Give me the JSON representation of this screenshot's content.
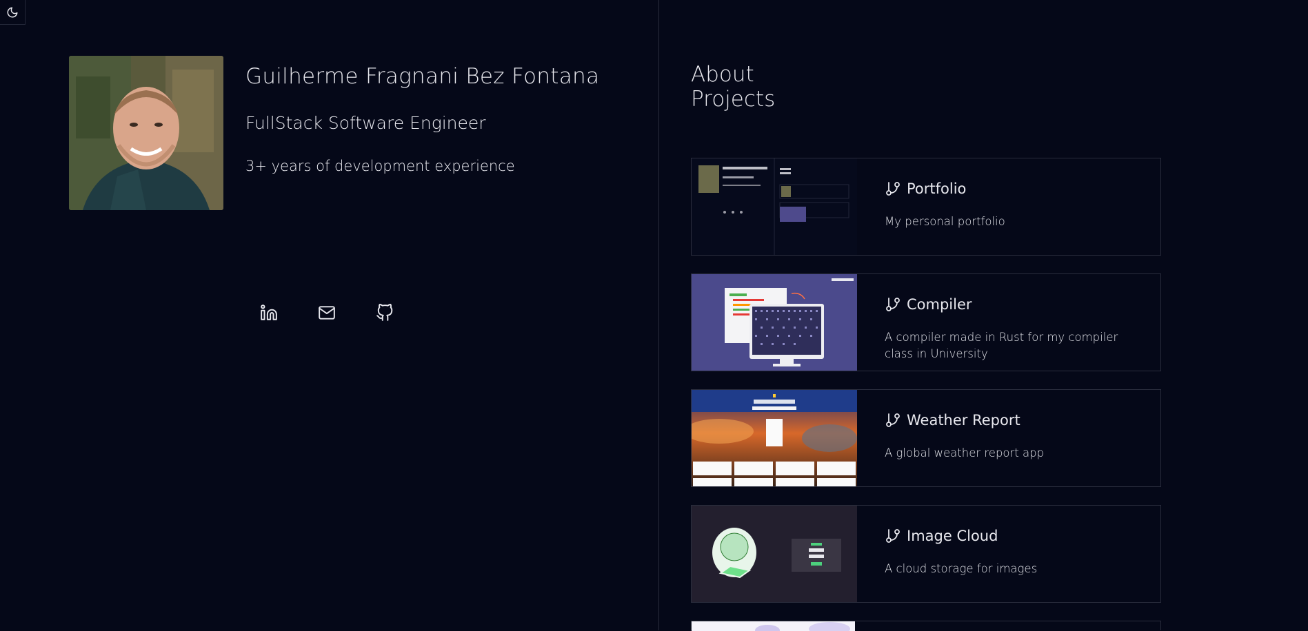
{
  "theme_toggle": {
    "icon": "moon-icon"
  },
  "profile": {
    "name": "Guilherme Fragnani Bez Fontana",
    "role": "FullStack Software Engineer",
    "experience": "3+ years of development experience",
    "photo_alt": "Profile photo"
  },
  "socials": [
    {
      "icon": "linkedin-icon"
    },
    {
      "icon": "mail-icon"
    },
    {
      "icon": "github-icon"
    }
  ],
  "about": {
    "title": "About Projects"
  },
  "projects": [
    {
      "title": "Portfolio",
      "description": "My personal portfolio",
      "icon": "git-branch-icon"
    },
    {
      "title": "Compiler",
      "description": "A compiler made in Rust for my compiler class in University",
      "icon": "git-branch-icon"
    },
    {
      "title": "Weather Report",
      "description": "A global weather report app",
      "icon": "git-branch-icon"
    },
    {
      "title": "Image Cloud",
      "description": "A cloud storage for images",
      "icon": "git-branch-icon"
    }
  ],
  "colors": {
    "background": "#050818",
    "border": "#2a2d3d",
    "text": "#e8e8ee"
  }
}
